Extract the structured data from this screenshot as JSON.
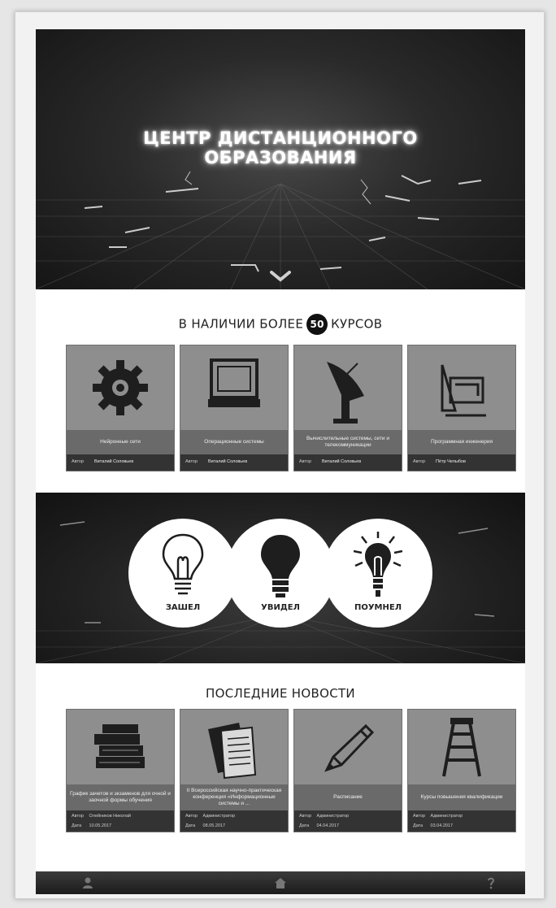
{
  "hero": {
    "title_line1": "ЦЕНТР ДИСТАНЦИОННОГО",
    "title_line2": "ОБРАЗОВАНИЯ",
    "scroll_icon": "chevron-down-icon"
  },
  "courses": {
    "heading_before": "В НАЛИЧИИ БОЛЕЕ",
    "count": "50",
    "heading_after": "КУРСОВ",
    "author_label": "Автор",
    "items": [
      {
        "title": "Нейронные сети",
        "author": "Виталий Соловьев",
        "icon": "gear-icon"
      },
      {
        "title": "Операционные системы",
        "author": "Виталий Соловьев",
        "icon": "monitor-icon"
      },
      {
        "title": "Вычислительные системы, сети и телекоммуникации",
        "author": "Виталий Соловьев",
        "icon": "satellite-dish-icon"
      },
      {
        "title": "Программная инженерия",
        "author": "Пётр Чепыбов",
        "icon": "drafting-tools-icon"
      }
    ]
  },
  "motto": {
    "items": [
      {
        "label": "ЗАШЕЛ",
        "icon": "lightbulb-outline-icon"
      },
      {
        "label": "УВИДЕЛ",
        "icon": "lightbulb-filled-icon"
      },
      {
        "label": "ПОУМНЕЛ",
        "icon": "lightbulb-glowing-icon"
      }
    ]
  },
  "news": {
    "heading": "ПОСЛЕДНИЕ НОВОСТИ",
    "author_label": "Автор",
    "date_label": "Дата",
    "items": [
      {
        "title": "График зачетов и экзаменов для очной и заочной формы обучения",
        "author": "Олейников Николай",
        "date": "10.05.2017",
        "icon": "books-icon"
      },
      {
        "title": "II Всероссийская научно-практическая конференция «Информационные системы и ...",
        "author": "Администратор",
        "date": "08.05.2017",
        "icon": "documents-icon"
      },
      {
        "title": "Расписание",
        "author": "Администратор",
        "date": "04.04.2017",
        "icon": "pencil-icon"
      },
      {
        "title": "Курсы повышения квалификации",
        "author": "Администратор",
        "date": "03.04.2017",
        "icon": "ladder-icon"
      }
    ]
  },
  "footer": {
    "left_icon": "user-icon",
    "center_icon": "home-icon",
    "right_icon": "question-icon"
  }
}
